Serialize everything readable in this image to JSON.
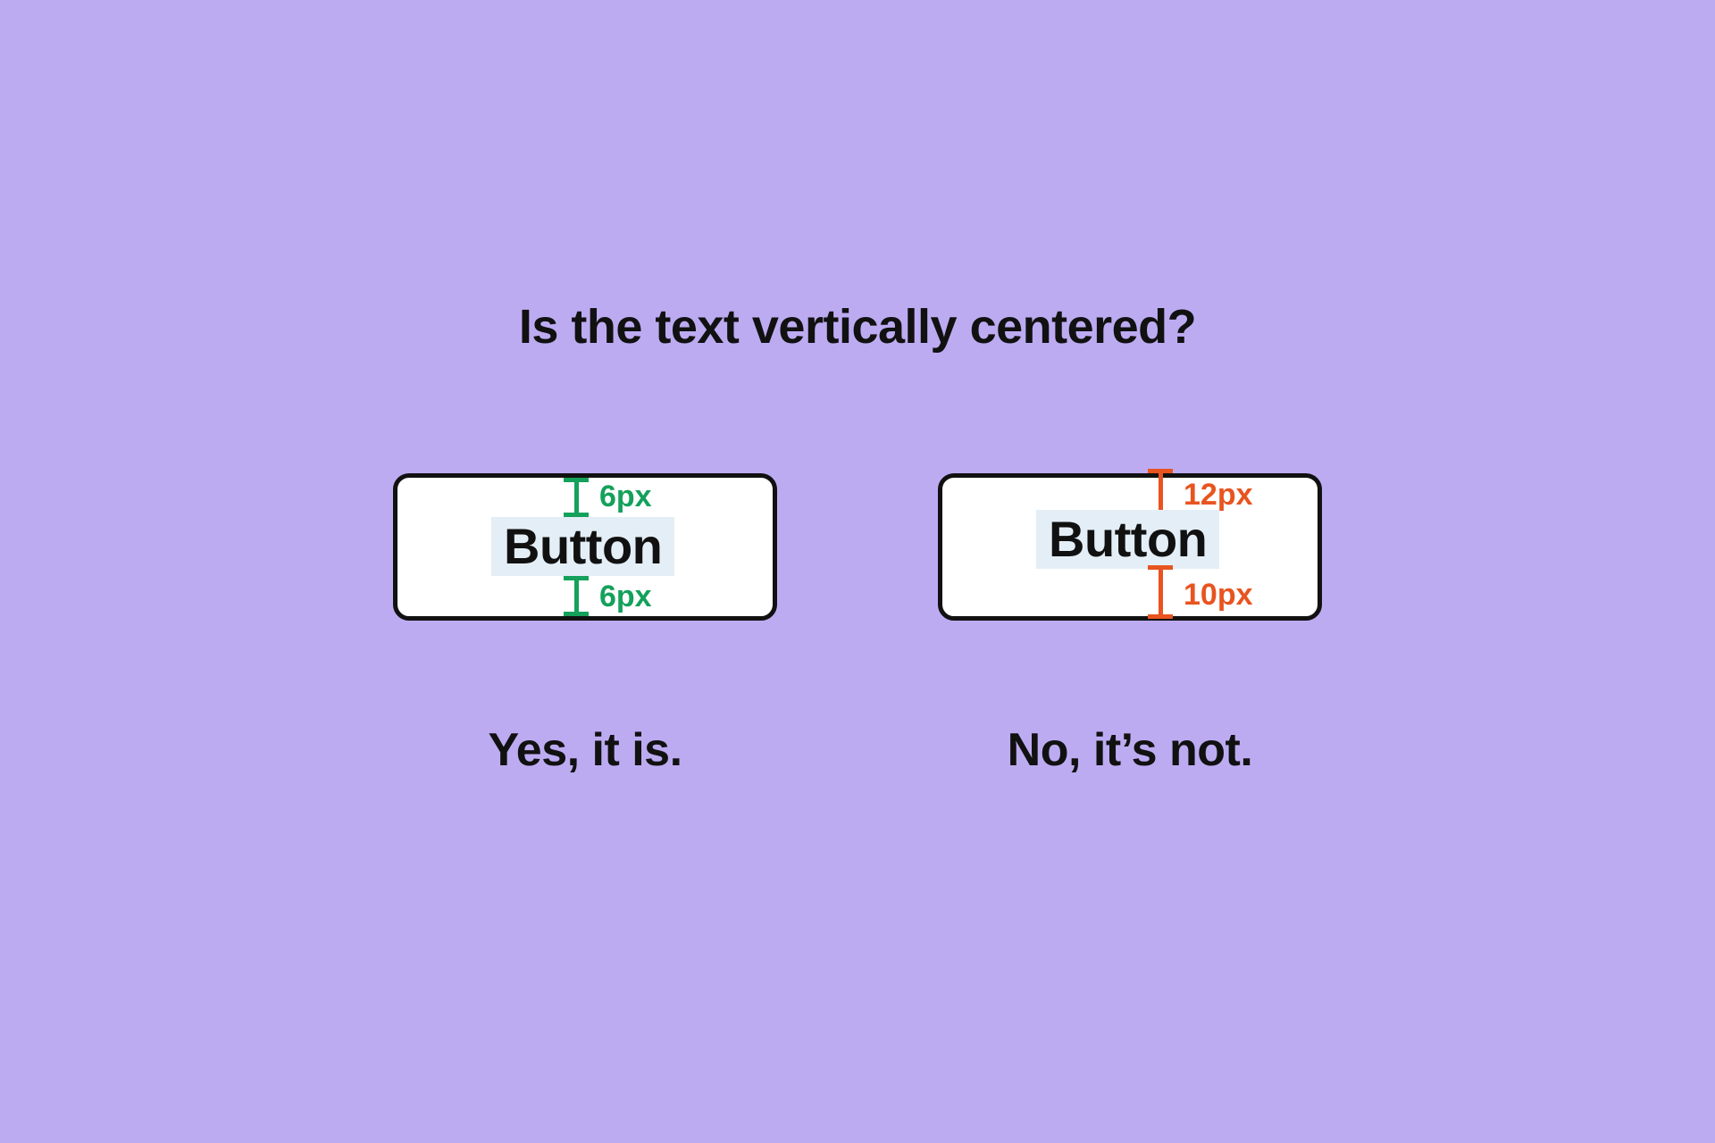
{
  "heading": "Is the text vertically centered?",
  "examples": {
    "yes": {
      "button_label": "Button",
      "top_measure": "6px",
      "bottom_measure": "6px",
      "caption": "Yes, it is.",
      "color": "#14a15b"
    },
    "no": {
      "button_label": "Button",
      "top_measure": "12px",
      "bottom_measure": "10px",
      "caption": "No, it’s not.",
      "color": "#e8541f"
    }
  },
  "colors": {
    "background": "#bdabf2",
    "text": "#111111",
    "highlight": "#e4eef6"
  }
}
